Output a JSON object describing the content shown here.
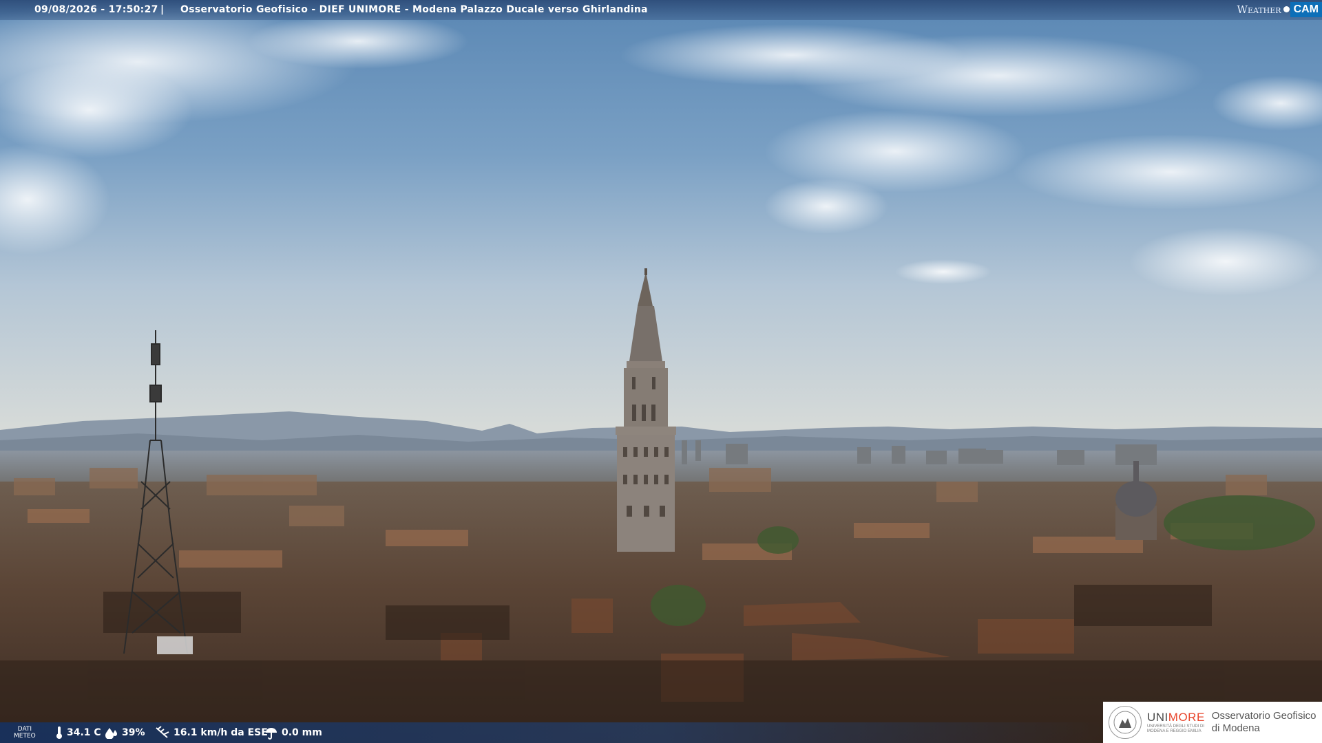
{
  "overlay_top": {
    "timestamp": "09/08/2026 - 17:50:27",
    "separator": "|",
    "camera_title": "Osservatorio Geofisico - DIEF UNIMORE - Modena Palazzo Ducale verso Ghirlandina"
  },
  "brand": {
    "part1": "Weather",
    "part2": "CAM"
  },
  "overlay_bottom": {
    "label_line1": "DATI",
    "label_line2": "METEO",
    "temperature": "34.1 C",
    "humidity": "39%",
    "wind": "16.1 km/h da ESE",
    "rain": "0.0 mm"
  },
  "logo": {
    "uni_part1": "UNI",
    "uni_part2": "MORE",
    "uni_sub1": "UNIVERSITÀ DEGLI STUDI DI",
    "uni_sub2": "MODENA E REGGIO EMILIA",
    "osserv_line1": "Osservatorio Geofisico",
    "osserv_line2": "di Modena"
  },
  "icons": [
    "thermometer-icon",
    "humidity-drop-icon",
    "wind-icon",
    "rain-icon",
    "university-seal-icon"
  ],
  "colors": {
    "topbar": "#2a4a78",
    "brand_cam": "#0d6fb8",
    "unimore_accent": "#e8452c"
  }
}
